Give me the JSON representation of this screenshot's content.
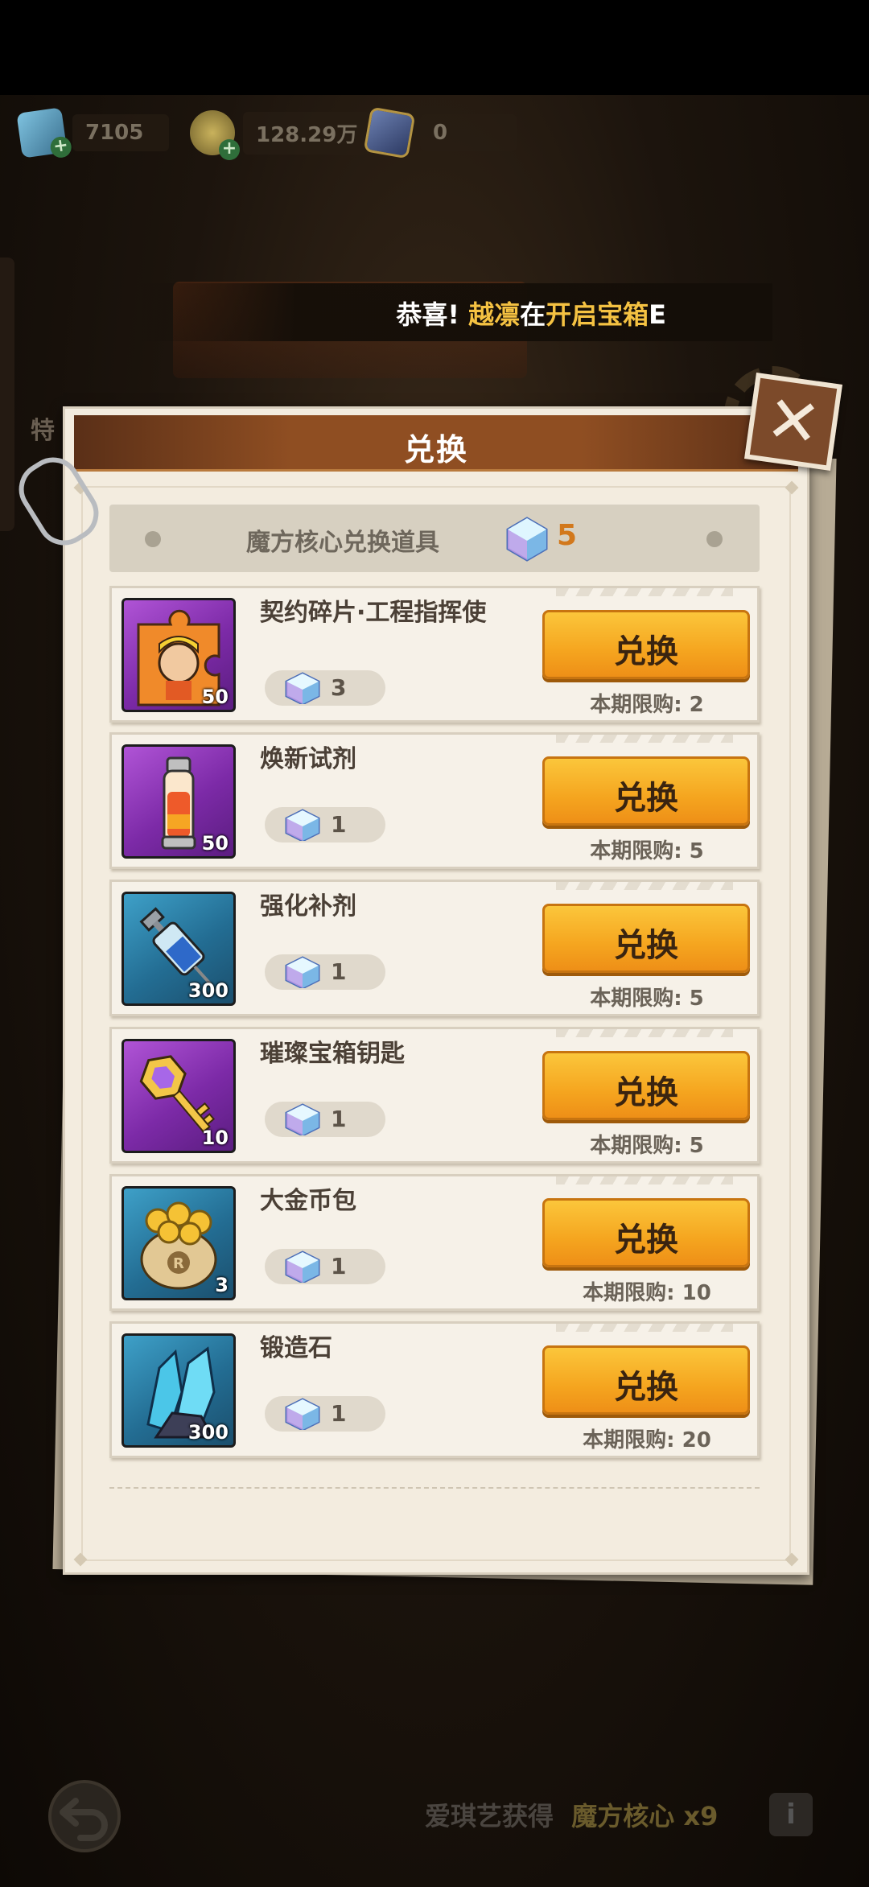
{
  "resources": [
    {
      "icon": "gem-icon",
      "value": "7105"
    },
    {
      "icon": "coin-icon",
      "value": "128.29万"
    },
    {
      "icon": "ticket-icon",
      "value": "0"
    }
  ],
  "ticker": {
    "prefix": "恭喜!",
    "name": "越凛",
    "mid": "在",
    "event": "开启宝箱",
    "tail": "E"
  },
  "side_label": "特",
  "dialog": {
    "title": "兑换",
    "currency_label": "魔方核心兑换道具",
    "currency_value": "5",
    "items": [
      {
        "name": "契约碎片·工程指挥使",
        "qty": "50",
        "cost": "3",
        "button": "兑换",
        "limit": "本期限购: 2",
        "bg": "purple",
        "art": "puzzle"
      },
      {
        "name": "焕新试剂",
        "qty": "50",
        "cost": "1",
        "button": "兑换",
        "limit": "本期限购: 5",
        "bg": "purple",
        "art": "vial"
      },
      {
        "name": "强化补剂",
        "qty": "300",
        "cost": "1",
        "button": "兑换",
        "limit": "本期限购: 5",
        "bg": "blue",
        "art": "syringe"
      },
      {
        "name": "璀璨宝箱钥匙",
        "qty": "10",
        "cost": "1",
        "button": "兑换",
        "limit": "本期限购: 5",
        "bg": "purple",
        "art": "key"
      },
      {
        "name": "大金币包",
        "qty": "3",
        "cost": "1",
        "button": "兑换",
        "limit": "本期限购: 10",
        "bg": "blue",
        "art": "coinbag"
      },
      {
        "name": "锻造石",
        "qty": "300",
        "cost": "1",
        "button": "兑换",
        "limit": "本期限购: 20",
        "bg": "blue",
        "art": "crystal"
      }
    ]
  },
  "bottom": {
    "text": "爱琪艺获得",
    "reward": "魔方核心 x9",
    "info": "i"
  },
  "colors": {
    "button": "#f5a51f",
    "title_bar": "#8f4e22",
    "paper": "#f3ecdf",
    "currency_value": "#d2781c"
  }
}
